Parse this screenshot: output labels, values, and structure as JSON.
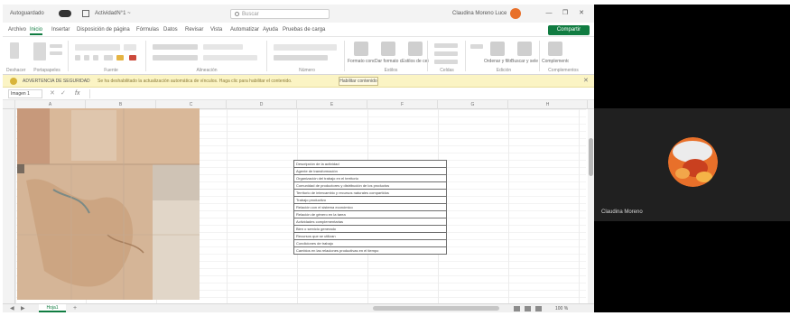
{
  "title_bar": {
    "autosave": "Autoguardado",
    "filename": "ActividadN°1 ~",
    "search": "Buscar",
    "user": "Claudina Moreno Lucero",
    "window_controls": [
      "—",
      "❐",
      "✕"
    ]
  },
  "ribbon_tabs": [
    "Archivo",
    "Inicio",
    "Insertar",
    "Disposición de página",
    "Fórmulas",
    "Datos",
    "Revisar",
    "Vista",
    "Automatizar",
    "Ayuda",
    "Pruebas de carga"
  ],
  "active_tab": "Inicio",
  "share_label": "Compartir",
  "ribbon_groups": [
    "Deshacer",
    "Portapapeles",
    "Fuente",
    "Alineación",
    "Número",
    "Estilos",
    "Celdas",
    "Edición",
    "Complementos"
  ],
  "ribbon_captions": [
    "Formato condicional",
    "Dar formato como tabla",
    "Estilos de celda",
    "Ordenar y filtrar",
    "Buscar y seleccionar",
    "Complementos"
  ],
  "info_bar": {
    "label": "ADVERTENCIA DE SEGURIDAD",
    "message": "Se ha deshabilitado la actualización automática de vínculos. Haga clic para habilitar el contenido.",
    "button": "Habilitar contenido",
    "close": "✕"
  },
  "formula_bar": {
    "name_box": "Imagen 1",
    "fx": "fx"
  },
  "columns": [
    "A",
    "B",
    "C",
    "D",
    "E",
    "F",
    "G",
    "H"
  ],
  "table_rows": [
    "Descripción de la actividad",
    "Agente de transformación",
    "Organización del trabajo en el territorio",
    "Comunidad de productores y distribución de los productos",
    "Territorio de intercambio y recursos naturales compartidos",
    "Trabajo productivo",
    "Relación con el sistema económico",
    "Relación de género en la tarea",
    "Actividades complementarias",
    "Bien o servicio generado",
    "Recursos que se utilizan",
    "Condiciones de trabajo",
    "Cambios en las relaciones productivas en el tiempo"
  ],
  "status_bar": {
    "sheet": "Hoja1",
    "zoom": "100 %"
  },
  "meeting": {
    "participant_name": "Claudina Moreno"
  },
  "colors": {
    "excel_green": "#107c41",
    "info_bar": "#fbf4c4",
    "meeting_bg": "#000000",
    "avatar_orange": "#e8702a"
  }
}
